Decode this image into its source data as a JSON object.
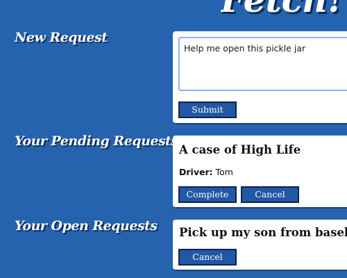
{
  "app": {
    "logo_text": "Fetch!"
  },
  "new_request": {
    "heading": "New Request",
    "textarea_value": "Help me open this pickle jar",
    "submit_label": "Submit"
  },
  "pending": {
    "heading": "Your Pending Requests",
    "items": [
      {
        "title": "A case of High Life",
        "driver_label": "Driver:",
        "driver_name": "Tom",
        "complete_label": "Complete",
        "cancel_label": "Cancel"
      }
    ]
  },
  "open": {
    "heading": "Your Open Requests",
    "items": [
      {
        "title": "Pick up my son from baseball practice",
        "cancel_label": "Cancel"
      }
    ]
  },
  "colors": {
    "background": "#2563ae",
    "button": "#2257a6",
    "button_border": "#0f2448",
    "card": "#ffffff",
    "textarea_focus_border": "#8cb3e6"
  }
}
